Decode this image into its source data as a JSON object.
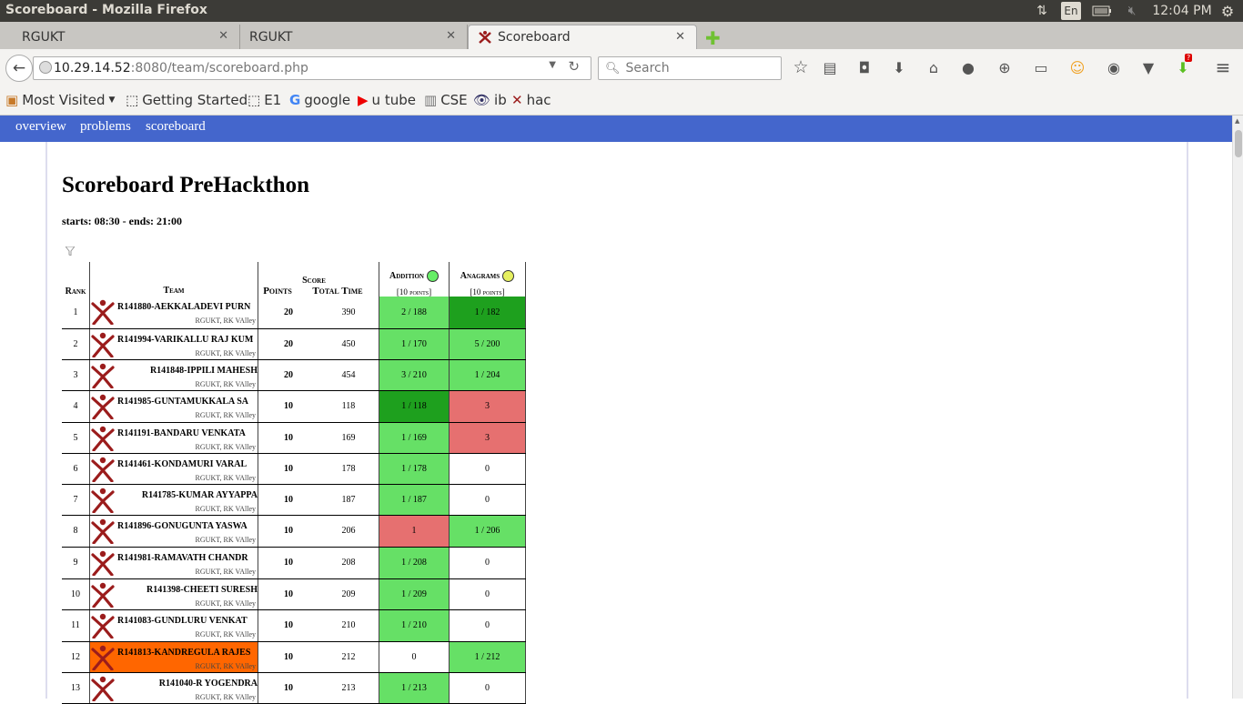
{
  "window": {
    "title": "Scoreboard - Mozilla Firefox",
    "keyboard": "En",
    "time": "12:04 PM"
  },
  "tabs": [
    {
      "label": "RGUKT",
      "active": false
    },
    {
      "label": "RGUKT",
      "active": false
    },
    {
      "label": "Scoreboard",
      "active": true
    }
  ],
  "address": {
    "host": "10.29.14.52",
    "path": ":8080/team/scoreboard.php"
  },
  "search": {
    "placeholder": "Search"
  },
  "bookmarks": [
    "Most Visited",
    "Getting Started",
    "E1",
    "google",
    "u tube",
    "CSE",
    "ib",
    "hac"
  ],
  "sitenav": [
    "overview",
    "problems",
    "scoreboard"
  ],
  "page": {
    "title": "Scoreboard PreHackthon",
    "times": "starts: 08:30 - ends: 21:00"
  },
  "table": {
    "headers": {
      "rank": "Rank",
      "team": "Team",
      "score": "Score",
      "points": "Points",
      "total_time": "Total Time"
    },
    "problems": [
      {
        "name": "Addition",
        "points": "[10 points]",
        "color": "#66ee66"
      },
      {
        "name": "Anagrams",
        "points": "[10 points]",
        "color": "#e6f060"
      }
    ],
    "affiliation": "RGUKT, RK VAlley",
    "rows": [
      {
        "rank": "1",
        "team": "R141880-AEKKALADEVI PURN",
        "points": "20",
        "time": "390",
        "p1": "2 / 188",
        "p2": "1 / 182"
      },
      {
        "rank": "2",
        "team": "R141994-VARIKALLU RAJ KUM",
        "points": "20",
        "time": "450",
        "p1": "1 / 170",
        "p2": "5 / 200"
      },
      {
        "rank": "3",
        "team": "R141848-IPPILI MAHESH",
        "points": "20",
        "time": "454",
        "p1": "3 / 210",
        "p2": "1 / 204"
      },
      {
        "rank": "4",
        "team": "R141985-GUNTAMUKKALA SA",
        "points": "10",
        "time": "118",
        "p1": "1 / 118",
        "p2": "3"
      },
      {
        "rank": "5",
        "team": "R141191-BANDARU VENKATA",
        "points": "10",
        "time": "169",
        "p1": "1 / 169",
        "p2": "3"
      },
      {
        "rank": "6",
        "team": "R141461-KONDAMURI VARAL",
        "points": "10",
        "time": "178",
        "p1": "1 / 178",
        "p2": "0"
      },
      {
        "rank": "7",
        "team": "R141785-KUMAR AYYAPPA",
        "points": "10",
        "time": "187",
        "p1": "1 / 187",
        "p2": "0"
      },
      {
        "rank": "8",
        "team": "R141896-GONUGUNTA YASWA",
        "points": "10",
        "time": "206",
        "p1": "1",
        "p2": "1 / 206"
      },
      {
        "rank": "9",
        "team": "R141981-RAMAVATH CHANDR",
        "points": "10",
        "time": "208",
        "p1": "1 / 208",
        "p2": "0"
      },
      {
        "rank": "10",
        "team": "R141398-CHEETI SURESH",
        "points": "10",
        "time": "209",
        "p1": "1 / 209",
        "p2": "0"
      },
      {
        "rank": "11",
        "team": "R141083-GUNDLURU VENKAT",
        "points": "10",
        "time": "210",
        "p1": "1 / 210",
        "p2": "0"
      },
      {
        "rank": "12",
        "team": "R141813-KANDREGULA RAJES",
        "points": "10",
        "time": "212",
        "p1": "0",
        "p2": "1 / 212"
      },
      {
        "rank": "13",
        "team": "R141040-R YOGENDRA",
        "points": "10",
        "time": "213",
        "p1": "1 / 213",
        "p2": "0"
      }
    ]
  }
}
